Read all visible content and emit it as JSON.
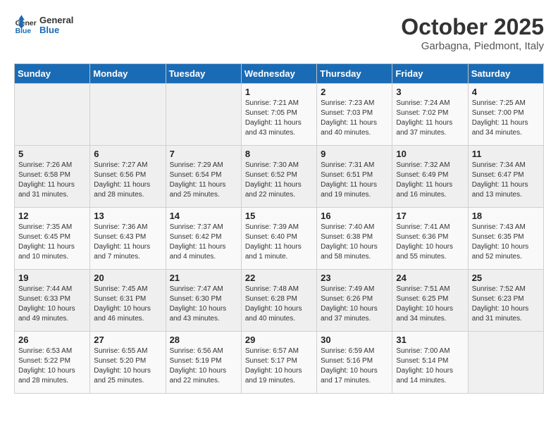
{
  "header": {
    "logo_line1": "General",
    "logo_line2": "Blue",
    "month": "October 2025",
    "location": "Garbagna, Piedmont, Italy"
  },
  "weekdays": [
    "Sunday",
    "Monday",
    "Tuesday",
    "Wednesday",
    "Thursday",
    "Friday",
    "Saturday"
  ],
  "weeks": [
    [
      {
        "day": "",
        "sunrise": "",
        "sunset": "",
        "daylight": ""
      },
      {
        "day": "",
        "sunrise": "",
        "sunset": "",
        "daylight": ""
      },
      {
        "day": "",
        "sunrise": "",
        "sunset": "",
        "daylight": ""
      },
      {
        "day": "1",
        "sunrise": "Sunrise: 7:21 AM",
        "sunset": "Sunset: 7:05 PM",
        "daylight": "Daylight: 11 hours and 43 minutes."
      },
      {
        "day": "2",
        "sunrise": "Sunrise: 7:23 AM",
        "sunset": "Sunset: 7:03 PM",
        "daylight": "Daylight: 11 hours and 40 minutes."
      },
      {
        "day": "3",
        "sunrise": "Sunrise: 7:24 AM",
        "sunset": "Sunset: 7:02 PM",
        "daylight": "Daylight: 11 hours and 37 minutes."
      },
      {
        "day": "4",
        "sunrise": "Sunrise: 7:25 AM",
        "sunset": "Sunset: 7:00 PM",
        "daylight": "Daylight: 11 hours and 34 minutes."
      }
    ],
    [
      {
        "day": "5",
        "sunrise": "Sunrise: 7:26 AM",
        "sunset": "Sunset: 6:58 PM",
        "daylight": "Daylight: 11 hours and 31 minutes."
      },
      {
        "day": "6",
        "sunrise": "Sunrise: 7:27 AM",
        "sunset": "Sunset: 6:56 PM",
        "daylight": "Daylight: 11 hours and 28 minutes."
      },
      {
        "day": "7",
        "sunrise": "Sunrise: 7:29 AM",
        "sunset": "Sunset: 6:54 PM",
        "daylight": "Daylight: 11 hours and 25 minutes."
      },
      {
        "day": "8",
        "sunrise": "Sunrise: 7:30 AM",
        "sunset": "Sunset: 6:52 PM",
        "daylight": "Daylight: 11 hours and 22 minutes."
      },
      {
        "day": "9",
        "sunrise": "Sunrise: 7:31 AM",
        "sunset": "Sunset: 6:51 PM",
        "daylight": "Daylight: 11 hours and 19 minutes."
      },
      {
        "day": "10",
        "sunrise": "Sunrise: 7:32 AM",
        "sunset": "Sunset: 6:49 PM",
        "daylight": "Daylight: 11 hours and 16 minutes."
      },
      {
        "day": "11",
        "sunrise": "Sunrise: 7:34 AM",
        "sunset": "Sunset: 6:47 PM",
        "daylight": "Daylight: 11 hours and 13 minutes."
      }
    ],
    [
      {
        "day": "12",
        "sunrise": "Sunrise: 7:35 AM",
        "sunset": "Sunset: 6:45 PM",
        "daylight": "Daylight: 11 hours and 10 minutes."
      },
      {
        "day": "13",
        "sunrise": "Sunrise: 7:36 AM",
        "sunset": "Sunset: 6:43 PM",
        "daylight": "Daylight: 11 hours and 7 minutes."
      },
      {
        "day": "14",
        "sunrise": "Sunrise: 7:37 AM",
        "sunset": "Sunset: 6:42 PM",
        "daylight": "Daylight: 11 hours and 4 minutes."
      },
      {
        "day": "15",
        "sunrise": "Sunrise: 7:39 AM",
        "sunset": "Sunset: 6:40 PM",
        "daylight": "Daylight: 11 hours and 1 minute."
      },
      {
        "day": "16",
        "sunrise": "Sunrise: 7:40 AM",
        "sunset": "Sunset: 6:38 PM",
        "daylight": "Daylight: 10 hours and 58 minutes."
      },
      {
        "day": "17",
        "sunrise": "Sunrise: 7:41 AM",
        "sunset": "Sunset: 6:36 PM",
        "daylight": "Daylight: 10 hours and 55 minutes."
      },
      {
        "day": "18",
        "sunrise": "Sunrise: 7:43 AM",
        "sunset": "Sunset: 6:35 PM",
        "daylight": "Daylight: 10 hours and 52 minutes."
      }
    ],
    [
      {
        "day": "19",
        "sunrise": "Sunrise: 7:44 AM",
        "sunset": "Sunset: 6:33 PM",
        "daylight": "Daylight: 10 hours and 49 minutes."
      },
      {
        "day": "20",
        "sunrise": "Sunrise: 7:45 AM",
        "sunset": "Sunset: 6:31 PM",
        "daylight": "Daylight: 10 hours and 46 minutes."
      },
      {
        "day": "21",
        "sunrise": "Sunrise: 7:47 AM",
        "sunset": "Sunset: 6:30 PM",
        "daylight": "Daylight: 10 hours and 43 minutes."
      },
      {
        "day": "22",
        "sunrise": "Sunrise: 7:48 AM",
        "sunset": "Sunset: 6:28 PM",
        "daylight": "Daylight: 10 hours and 40 minutes."
      },
      {
        "day": "23",
        "sunrise": "Sunrise: 7:49 AM",
        "sunset": "Sunset: 6:26 PM",
        "daylight": "Daylight: 10 hours and 37 minutes."
      },
      {
        "day": "24",
        "sunrise": "Sunrise: 7:51 AM",
        "sunset": "Sunset: 6:25 PM",
        "daylight": "Daylight: 10 hours and 34 minutes."
      },
      {
        "day": "25",
        "sunrise": "Sunrise: 7:52 AM",
        "sunset": "Sunset: 6:23 PM",
        "daylight": "Daylight: 10 hours and 31 minutes."
      }
    ],
    [
      {
        "day": "26",
        "sunrise": "Sunrise: 6:53 AM",
        "sunset": "Sunset: 5:22 PM",
        "daylight": "Daylight: 10 hours and 28 minutes."
      },
      {
        "day": "27",
        "sunrise": "Sunrise: 6:55 AM",
        "sunset": "Sunset: 5:20 PM",
        "daylight": "Daylight: 10 hours and 25 minutes."
      },
      {
        "day": "28",
        "sunrise": "Sunrise: 6:56 AM",
        "sunset": "Sunset: 5:19 PM",
        "daylight": "Daylight: 10 hours and 22 minutes."
      },
      {
        "day": "29",
        "sunrise": "Sunrise: 6:57 AM",
        "sunset": "Sunset: 5:17 PM",
        "daylight": "Daylight: 10 hours and 19 minutes."
      },
      {
        "day": "30",
        "sunrise": "Sunrise: 6:59 AM",
        "sunset": "Sunset: 5:16 PM",
        "daylight": "Daylight: 10 hours and 17 minutes."
      },
      {
        "day": "31",
        "sunrise": "Sunrise: 7:00 AM",
        "sunset": "Sunset: 5:14 PM",
        "daylight": "Daylight: 10 hours and 14 minutes."
      },
      {
        "day": "",
        "sunrise": "",
        "sunset": "",
        "daylight": ""
      }
    ]
  ]
}
